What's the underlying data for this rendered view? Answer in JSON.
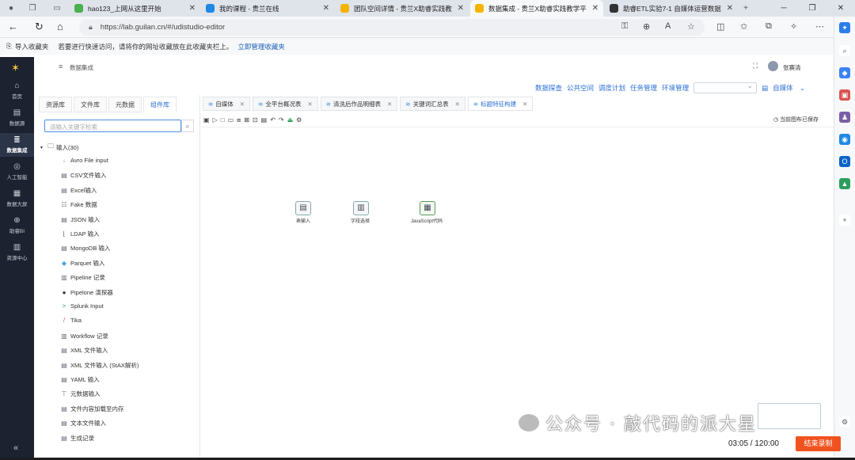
{
  "browser": {
    "tabs": [
      {
        "title": "hao123_上网从这里开始",
        "fav_color": "#4caf50",
        "active": false
      },
      {
        "title": "我的课程 - 贵兰在线",
        "fav_color": "#1e88e5",
        "active": false
      },
      {
        "title": "团队空间详情 - 贵兰X助睿实践教",
        "fav_color": "#f4b400",
        "active": false
      },
      {
        "title": "数据集成 - 贵兰X助睿实践教学平",
        "fav_color": "#f4b400",
        "active": true
      },
      {
        "title": "助睿ETL实验7-1 自媒体运营数据",
        "fav_color": "#333333",
        "active": false
      }
    ],
    "url": "https://lab.guilan.cn/#/udistudio-editor",
    "favbar": {
      "import_label": "导入收藏夹",
      "hint": "若要进行快速访问，请将你的网址收藏放在此收藏夹栏上。",
      "manage_link": "立即管理收藏夹"
    }
  },
  "app": {
    "sidebar": [
      {
        "label": "首页",
        "icon": "home-icon"
      },
      {
        "label": "数据源",
        "icon": "database-icon"
      },
      {
        "label": "数据集成",
        "icon": "integration-icon",
        "active": true
      },
      {
        "label": "人工智能",
        "icon": "ai-icon"
      },
      {
        "label": "数据大屏",
        "icon": "dashboard-icon"
      },
      {
        "label": "助睿BI",
        "icon": "bi-icon"
      },
      {
        "label": "资源中心",
        "icon": "resource-icon"
      }
    ],
    "breadcrumb": "数据集成",
    "username": "张赛清",
    "menu": [
      "数据探查",
      "公共空间",
      "调度计划",
      "任务管理",
      "环境管理"
    ],
    "workspace": "自媒体",
    "left_tabs": [
      "资源库",
      "文件库",
      "元数据",
      "组件库"
    ],
    "active_left_tab": 3,
    "search_placeholder": "请输入关键字检索",
    "tree_root": "输入(30)",
    "tree_items": [
      {
        "label": "Avro File input",
        "icon": "avro-icon"
      },
      {
        "label": "CSV文件输入",
        "icon": "file-icon"
      },
      {
        "label": "Excel输入",
        "icon": "file-icon"
      },
      {
        "label": "Fake 数据",
        "icon": "fake-data-icon"
      },
      {
        "label": "JSON 输入",
        "icon": "json-icon"
      },
      {
        "label": "LDAP 输入",
        "icon": "ldap-icon"
      },
      {
        "label": "MongoDB 输入",
        "icon": "mongodb-icon"
      },
      {
        "label": "Parquet 输入",
        "icon": "parquet-icon"
      },
      {
        "label": "Pipeline 记录",
        "icon": "pipeline-icon"
      },
      {
        "label": "Pipelone 演探器",
        "icon": "bulb-icon"
      },
      {
        "label": "Splunk Input",
        "icon": "splunk-icon"
      },
      {
        "label": "Tika",
        "icon": "tika-icon"
      },
      {
        "label": "Workflow 记录",
        "icon": "workflow-icon"
      },
      {
        "label": "XML 文件输入",
        "icon": "xml-icon"
      },
      {
        "label": "XML 文件输入 (StAX解析)",
        "icon": "xml-icon"
      },
      {
        "label": "YAML 输入",
        "icon": "yaml-icon"
      },
      {
        "label": "元数据输入",
        "icon": "metadata-icon"
      },
      {
        "label": "文件内容加载至内存",
        "icon": "file-icon"
      },
      {
        "label": "文本文件输入",
        "icon": "file-icon"
      },
      {
        "label": "生成记录",
        "icon": "generate-icon"
      }
    ],
    "editor_tabs": [
      {
        "label": "自媒体",
        "active": false
      },
      {
        "label": "全平台概况表",
        "active": false
      },
      {
        "label": "清洗后作品明细表",
        "active": false
      },
      {
        "label": "关键词汇总表",
        "active": false
      },
      {
        "label": "标题特征构建",
        "active": true
      }
    ],
    "saved_status": "当前图布已保存",
    "nodes": [
      {
        "label": "表输入",
        "icon": "table-input-icon"
      },
      {
        "label": "字段选择",
        "icon": "field-select-icon"
      },
      {
        "label": "JavaScript代码",
        "icon": "javascript-icon"
      }
    ]
  },
  "watermark": "公众号 · 敲代码的派大星",
  "recording": {
    "timer": "03:05 / 120:00",
    "end_label": "结束录制"
  }
}
